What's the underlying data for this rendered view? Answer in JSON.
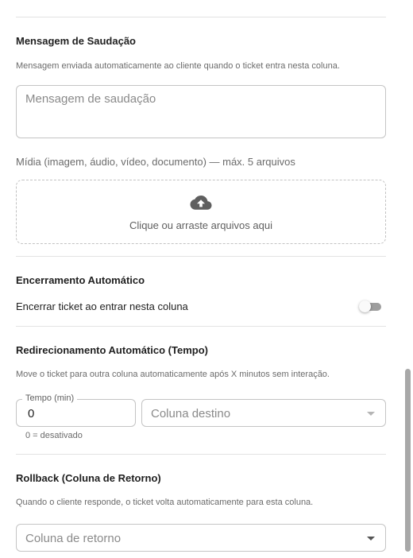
{
  "greeting": {
    "title": "Mensagem de Saudação",
    "description": "Mensagem enviada automaticamente ao cliente quando o ticket entra nesta coluna.",
    "placeholder": "Mensagem de saudação"
  },
  "media": {
    "label": "Mídia (imagem, áudio, vídeo, documento) — máx. 5 arquivos",
    "dropzone_text": "Clique ou arraste arquivos aqui"
  },
  "auto_close": {
    "title": "Encerramento Automático",
    "toggle_label": "Encerrar ticket ao entrar nesta coluna",
    "enabled": false
  },
  "auto_redirect": {
    "title": "Redirecionamento Automático (Tempo)",
    "description": "Move o ticket para outra coluna automaticamente após X minutos sem interação.",
    "time_label": "Tempo (min)",
    "time_value": "0",
    "time_helper": "0 = desativado",
    "dest_placeholder": "Coluna destino"
  },
  "rollback": {
    "title": "Rollback (Coluna de Retorno)",
    "description": "Quando o cliente responde, o ticket volta automaticamente para esta coluna.",
    "placeholder": "Coluna de retorno"
  }
}
